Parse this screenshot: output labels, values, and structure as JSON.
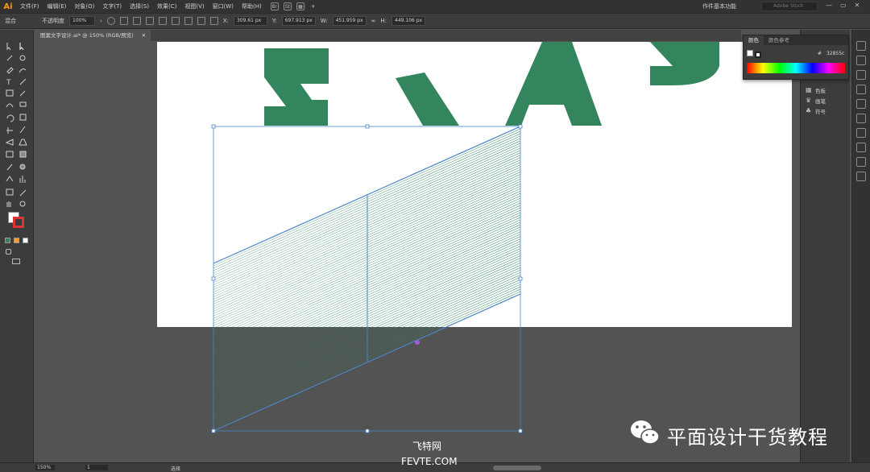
{
  "app": {
    "logo": "Ai"
  },
  "menu": [
    "文件(F)",
    "编辑(E)",
    "对象(O)",
    "文字(T)",
    "选择(S)",
    "效果(C)",
    "视图(V)",
    "窗口(W)",
    "帮助(H)"
  ],
  "menubar_right": {
    "workspace": "作件基本功能",
    "search_placeholder": "Adobe Stock",
    "controls": [
      "—",
      "▭",
      "✕"
    ]
  },
  "controlbar": {
    "label_blend": "混合",
    "opacity_label": "不透明度",
    "opacity_value": "100%",
    "x_value": "309.61 px",
    "y_value": "697.913 px",
    "w_value": "451.959 px",
    "h_value": "449.106 px"
  },
  "document_tab": {
    "title": "图案文字设计.ai* @ 150% (RGB/预览)",
    "close": "✕"
  },
  "color_panel": {
    "tabs": [
      "颜色",
      "颜色参考"
    ],
    "hex_prefix": "#",
    "hex_value": "32855c"
  },
  "dock_items": [
    {
      "label": "色板",
      "icon": "swatches-icon"
    },
    {
      "label": "画笔",
      "icon": "brush-icon"
    },
    {
      "label": "符号",
      "icon": "symbol-icon"
    }
  ],
  "statusbar": {
    "zoom": "150%",
    "page": "1",
    "mode": "选择"
  },
  "watermark": {
    "title": "平面设计干货教程",
    "site_cn": "飞特网",
    "site_en": "FEVTE.COM"
  },
  "colors": {
    "accent_green": "#32855c",
    "selection_blue": "#4a86c8",
    "ui_dark": "#3c3c3c"
  }
}
